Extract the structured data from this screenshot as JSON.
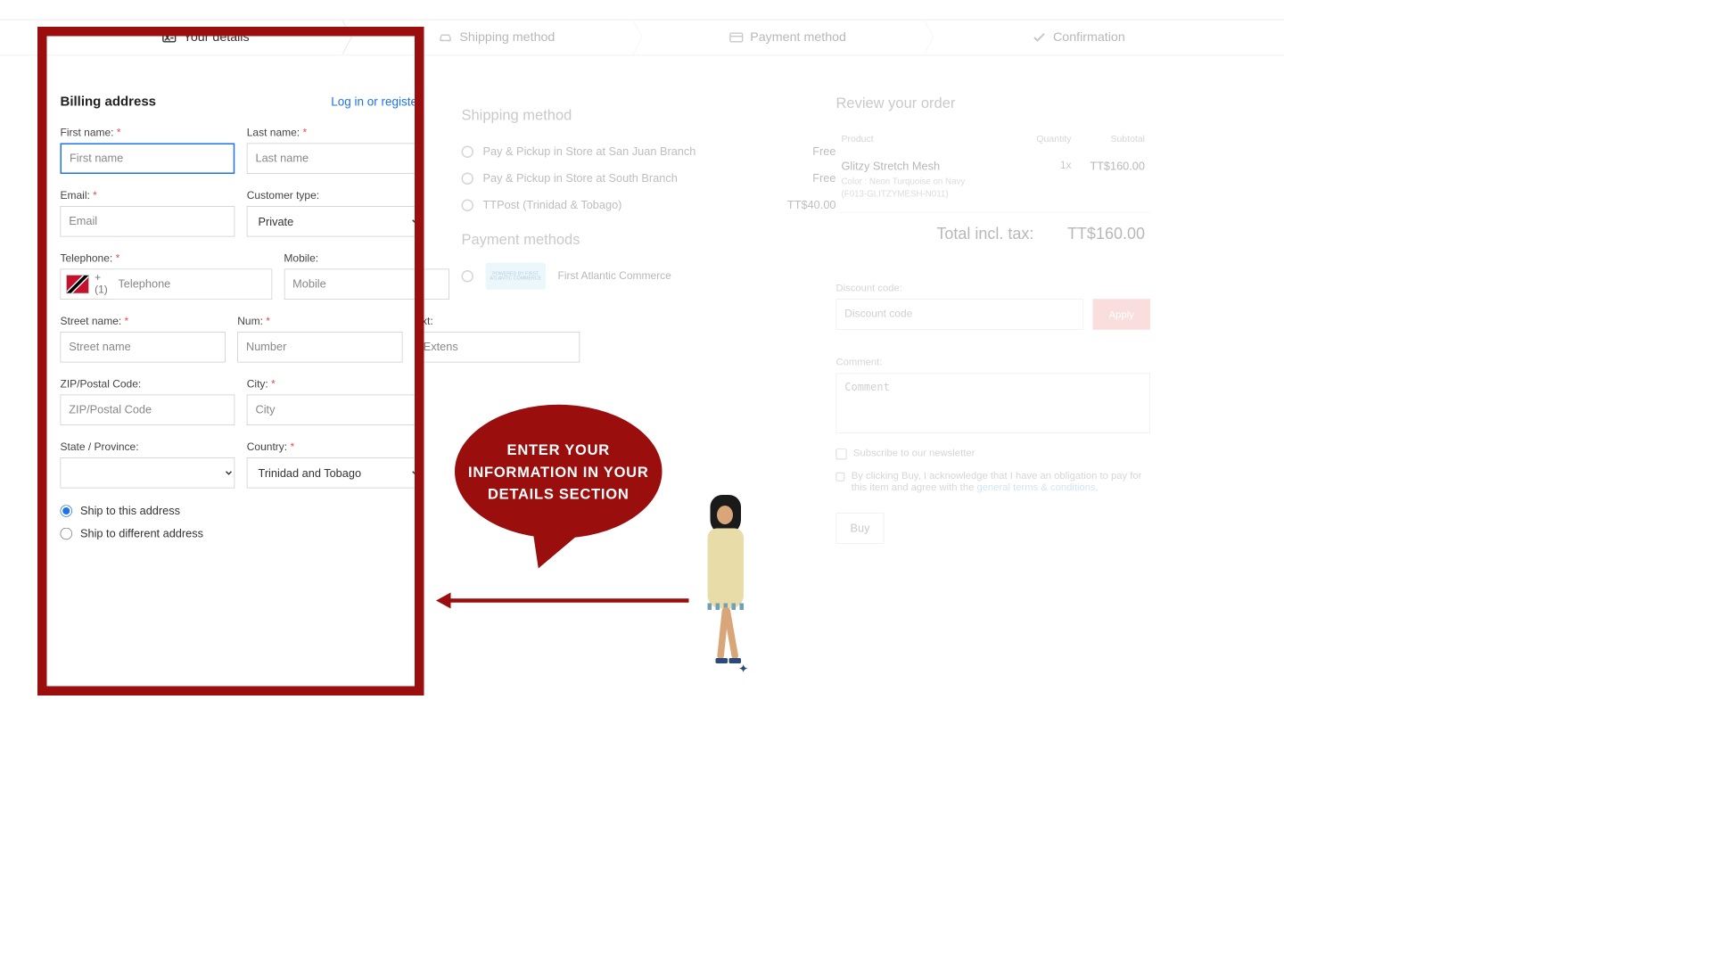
{
  "steps": {
    "details": "Your details",
    "shipping": "Shipping method",
    "payment": "Payment method",
    "confirm": "Confirmation"
  },
  "billing": {
    "title": "Billing address",
    "login_link": "Log in or register",
    "labels": {
      "first_name": "First name:",
      "last_name": "Last name:",
      "email": "Email:",
      "customer_type": "Customer type:",
      "telephone": "Telephone:",
      "mobile": "Mobile:",
      "street": "Street name:",
      "num": "Num:",
      "ext": "Ext:",
      "zip": "ZIP/Postal Code:",
      "city": "City:",
      "state": "State / Province:",
      "country": "Country:"
    },
    "placeholders": {
      "first_name": "First name",
      "last_name": "Last name",
      "email": "Email",
      "telephone": "Telephone",
      "mobile": "Mobile",
      "street": "Street name",
      "num": "Number",
      "ext": "Extens",
      "zip": "ZIP/Postal Code",
      "city": "City",
      "discount": "Discount code",
      "comment": "Comment"
    },
    "values": {
      "customer_type": "Private",
      "tel_prefix": "+ (1)",
      "country": "Trinidad and Tobago"
    },
    "ship_choice": {
      "same": "Ship to this address",
      "diff": "Ship to different address"
    }
  },
  "shipping": {
    "title": "Shipping method",
    "options": [
      {
        "label": "Pay & Pickup in Store at San Juan Branch",
        "price": "Free"
      },
      {
        "label": "Pay & Pickup in Store at South Branch",
        "price": "Free"
      },
      {
        "label": "TTPost (Trinidad & Tobago)",
        "price": "TT$40.00"
      }
    ]
  },
  "payment": {
    "title": "Payment methods",
    "option": "First Atlantic Commerce",
    "badge": "POWERED BY FIRST ATLANTIC COMMERCE"
  },
  "review": {
    "title": "Review your order",
    "cols": {
      "product": "Product",
      "qty": "Quantity",
      "sub": "Subtotal"
    },
    "item": {
      "name": "Glitzy Stretch Mesh",
      "meta1": "Color : Neon Turquoise on Navy",
      "meta2": "(F013-GLITZYMESH-N011)",
      "qty": "1x",
      "sub": "TT$160.00"
    },
    "total_label": "Total incl. tax:",
    "total_value": "TT$160.00",
    "discount_label": "Discount code:",
    "apply": "Apply",
    "comment_label": "Comment:",
    "newsletter": "Subscribe to our newsletter",
    "ack_pre": "By clicking Buy, I acknowledge that I have an obligation to pay for this item and agree with the ",
    "ack_link": "general terms & conditions",
    "buy": "Buy"
  },
  "annotation": {
    "bubble": "ENTER YOUR INFORMATION IN YOUR DETAILS SECTION"
  },
  "colors": {
    "brand_red": "#9a0e0e",
    "link_blue": "#1e73e8"
  }
}
